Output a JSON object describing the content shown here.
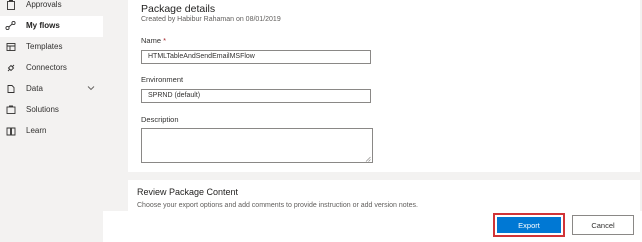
{
  "sidebar": {
    "items": [
      {
        "label": "Approvals",
        "icon": "approvals-icon"
      },
      {
        "label": "My flows",
        "icon": "my-flows-icon",
        "active": true
      },
      {
        "label": "Templates",
        "icon": "templates-icon"
      },
      {
        "label": "Connectors",
        "icon": "connectors-icon"
      },
      {
        "label": "Data",
        "icon": "data-icon",
        "expandable": true
      },
      {
        "label": "Solutions",
        "icon": "solutions-icon"
      },
      {
        "label": "Learn",
        "icon": "learn-icon"
      }
    ]
  },
  "package": {
    "title": "Package details",
    "subtitle": "Created by Habibur Rahaman on 08/01/2019",
    "name_label": "Name",
    "name_required": "*",
    "name_value": "HTMLTableAndSendEmailMSFlow",
    "environment_label": "Environment",
    "environment_value": "SPRND (default)",
    "description_label": "Description",
    "description_value": ""
  },
  "review": {
    "title": "Review Package Content",
    "subtitle": "Choose your export options and add comments to provide instruction or add version notes."
  },
  "footer": {
    "export_label": "Export",
    "cancel_label": "Cancel"
  },
  "colors": {
    "accent": "#0078d4",
    "highlight_border": "#d13438",
    "required": "#a4262c"
  }
}
